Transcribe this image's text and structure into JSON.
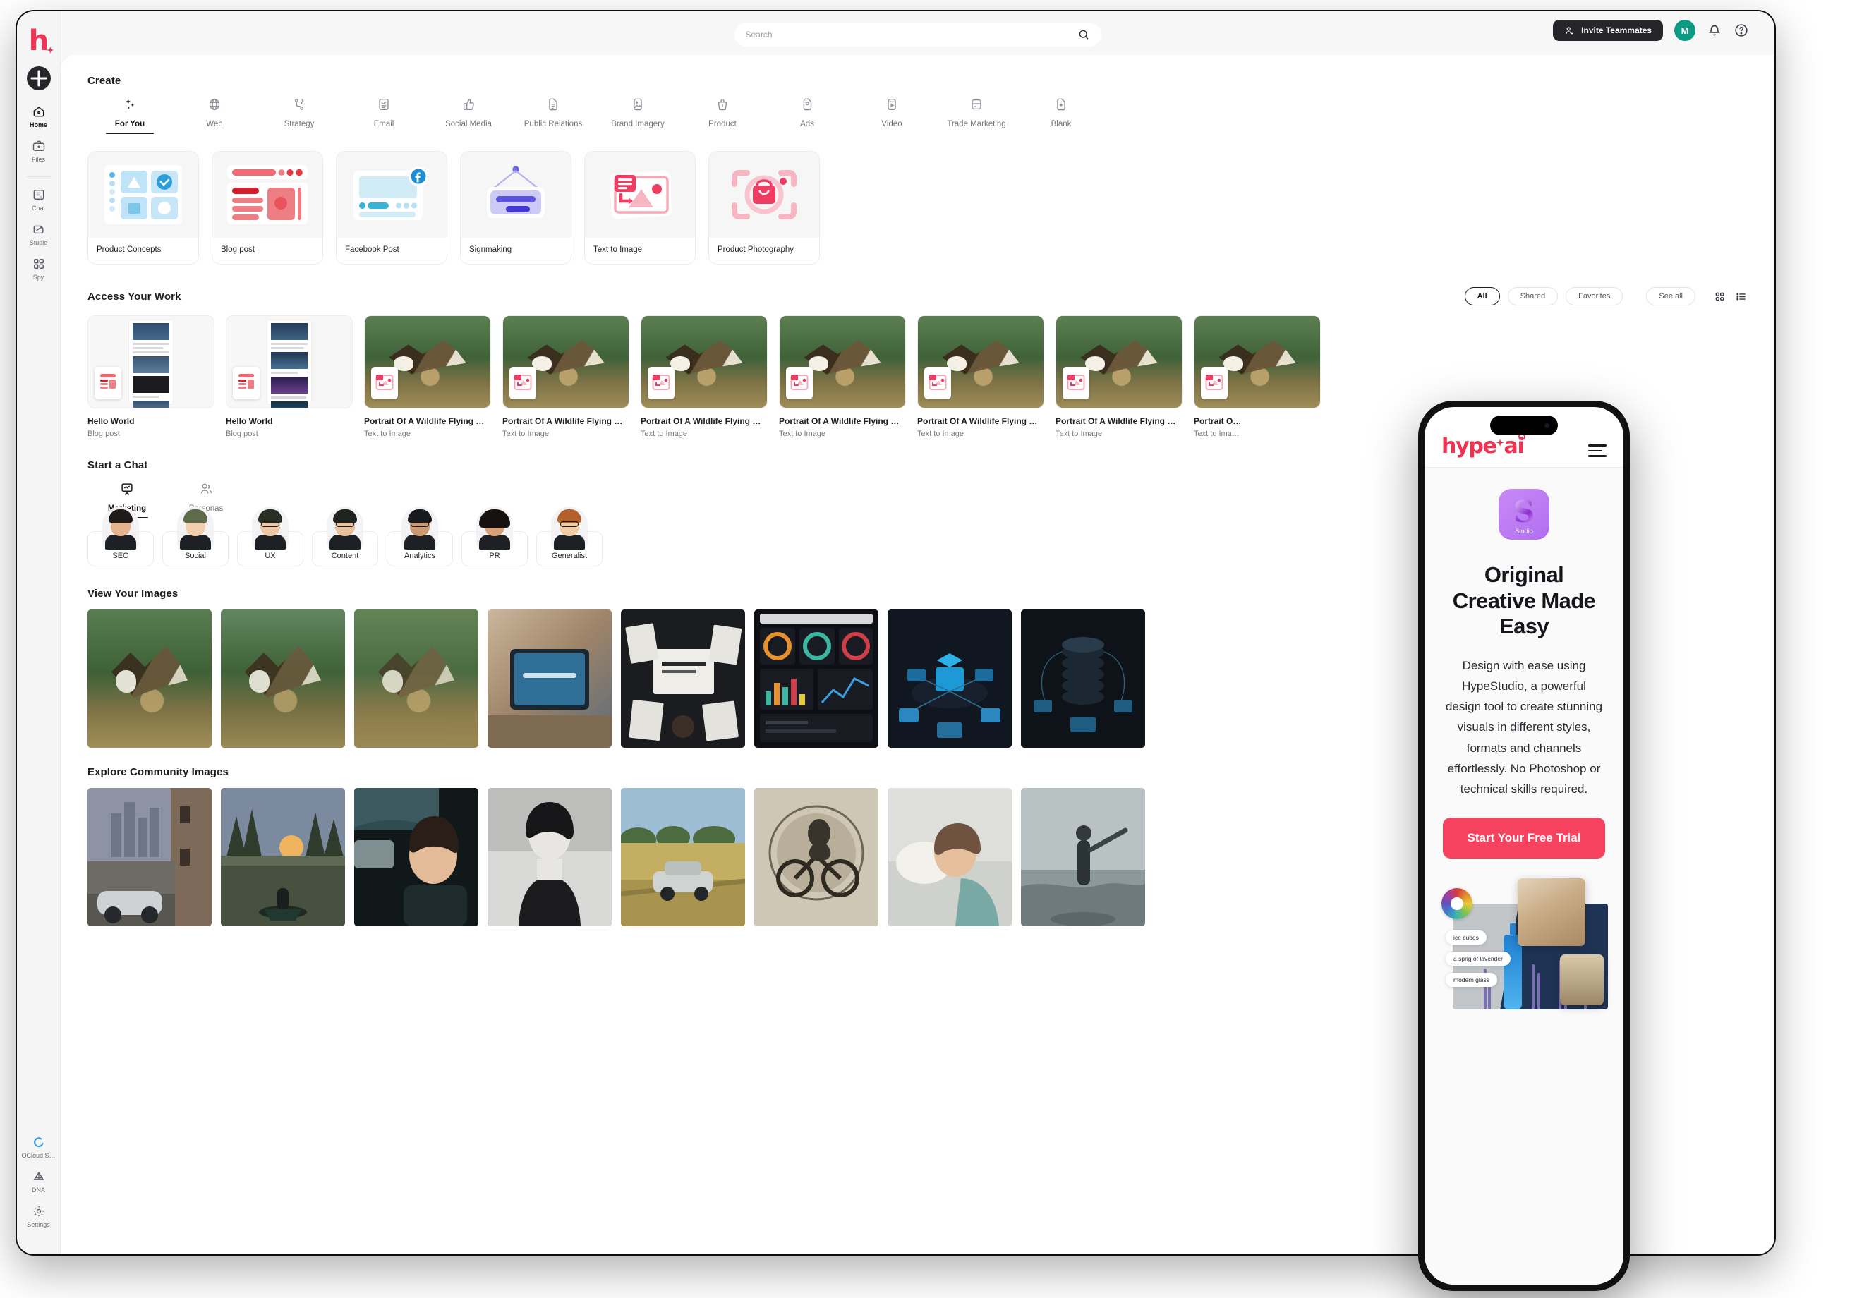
{
  "brand": {
    "logo_letter": "h",
    "name": "hype ai"
  },
  "rail": {
    "add_label": "+",
    "items": [
      {
        "label": "Home",
        "icon": "home-icon",
        "active": true
      },
      {
        "label": "Files",
        "icon": "briefcase-icon",
        "active": false
      },
      {
        "label": "Chat",
        "icon": "chat-doc-icon",
        "active": false
      },
      {
        "label": "Studio",
        "icon": "studio-icon",
        "active": false
      },
      {
        "label": "Spy",
        "icon": "grid-icon",
        "active": false
      }
    ],
    "bottom_items": [
      {
        "label": "OCloud S…",
        "icon": "cloud-loader-icon"
      },
      {
        "label": "DNA",
        "icon": "dna-icon"
      },
      {
        "label": "Settings",
        "icon": "gear-icon"
      }
    ]
  },
  "topbar": {
    "search_placeholder": "Search",
    "search_value": "",
    "invite_label": "Invite Teammates",
    "avatar_initial": "M",
    "icons": [
      "search-icon",
      "person-add-icon",
      "bell-icon",
      "help-circle-icon"
    ]
  },
  "create": {
    "title": "Create",
    "tabs": [
      {
        "label": "For You",
        "icon": "sparkle-icon",
        "active": true
      },
      {
        "label": "Web",
        "icon": "globe-icon",
        "active": false
      },
      {
        "label": "Strategy",
        "icon": "branch-icon",
        "active": false
      },
      {
        "label": "Email",
        "icon": "email-doc-icon",
        "active": false
      },
      {
        "label": "Social Media",
        "icon": "thumbs-up-icon",
        "active": false
      },
      {
        "label": "Public Relations",
        "icon": "doc-lines-icon",
        "active": false
      },
      {
        "label": "Brand Imagery",
        "icon": "image-doc-icon",
        "active": false
      },
      {
        "label": "Product",
        "icon": "basket-icon",
        "active": false
      },
      {
        "label": "Ads",
        "icon": "tag-pin-icon",
        "active": false
      },
      {
        "label": "Video",
        "icon": "video-play-icon",
        "active": false
      },
      {
        "label": "Trade Marketing",
        "icon": "card-icon",
        "active": false
      },
      {
        "label": "Blank",
        "icon": "doc-plus-icon",
        "active": false
      }
    ],
    "templates": [
      {
        "name": "Product Concepts",
        "art": "product-concepts-art"
      },
      {
        "name": "Blog post",
        "art": "blog-post-art"
      },
      {
        "name": "Facebook Post",
        "art": "facebook-post-art"
      },
      {
        "name": "Signmaking",
        "art": "signmaking-art"
      },
      {
        "name": "Text to Image",
        "art": "text-to-image-art"
      },
      {
        "name": "Product Photography",
        "art": "product-photography-art"
      }
    ]
  },
  "work": {
    "title": "Access Your Work",
    "filters": [
      {
        "label": "All",
        "active": true
      },
      {
        "label": "Shared",
        "active": false
      },
      {
        "label": "Favorites",
        "active": false
      },
      {
        "label": "See all",
        "active": false
      }
    ],
    "view_icons": [
      "grid-view-icon",
      "list-view-icon"
    ],
    "items": [
      {
        "title": "Hello World",
        "subtitle": "Blog post",
        "thumb": "doc"
      },
      {
        "title": "Hello World",
        "subtitle": "Blog post",
        "thumb": "doc"
      },
      {
        "title": "Portrait Of A Wildlife Flying …",
        "subtitle": "Text to Image",
        "thumb": "eagle"
      },
      {
        "title": "Portrait Of A Wildlife Flying …",
        "subtitle": "Text to Image",
        "thumb": "eagle"
      },
      {
        "title": "Portrait Of A Wildlife Flying …",
        "subtitle": "Text to Image",
        "thumb": "eagle"
      },
      {
        "title": "Portrait Of A Wildlife Flying …",
        "subtitle": "Text to Image",
        "thumb": "eagle"
      },
      {
        "title": "Portrait Of A Wildlife Flying …",
        "subtitle": "Text to Image",
        "thumb": "eagle"
      },
      {
        "title": "Portrait Of A Wildlife Flying …",
        "subtitle": "Text to Image",
        "thumb": "eagle"
      },
      {
        "title": "Portrait O…",
        "subtitle": "Text to Ima…",
        "thumb": "eagle"
      }
    ]
  },
  "chat": {
    "title": "Start a Chat",
    "tabs": [
      {
        "label": "Marketing",
        "icon": "presentation-icon",
        "active": true
      },
      {
        "label": "Personas",
        "icon": "people-icon",
        "active": false
      }
    ],
    "personas": [
      {
        "label": "SEO",
        "skin": "#e4b48f",
        "hair": "#1e1b18",
        "glasses": false
      },
      {
        "label": "Social",
        "skin": "#f1cfae",
        "hair": "#5d6b4a",
        "glasses": false
      },
      {
        "label": "UX",
        "skin": "#eec8a6",
        "hair": "#2a2f25",
        "glasses": true
      },
      {
        "label": "Content",
        "skin": "#e8c2a0",
        "hair": "#20231d",
        "glasses": true
      },
      {
        "label": "Analytics",
        "skin": "#c99a72",
        "hair": "#191a1d",
        "glasses": true
      },
      {
        "label": "PR",
        "skin": "#d7a079",
        "hair": "#15120f",
        "glasses": false
      },
      {
        "label": "Generalist",
        "skin": "#f0cda7",
        "hair": "#b2612a",
        "glasses": true
      }
    ]
  },
  "your_images": {
    "title": "View Your Images",
    "tiles": [
      {
        "alt": "bald eagle flying over forest",
        "scene": "sc-eagle1"
      },
      {
        "alt": "bald eagle landing",
        "scene": "sc-eagle2"
      },
      {
        "alt": "bird flying over grass",
        "scene": "sc-bird"
      },
      {
        "alt": "hands holding tablet on desk",
        "scene": "sc-tablet"
      },
      {
        "alt": "tech desk with papers and laptop",
        "scene": "sc-desk"
      },
      {
        "alt": "dark analytics dashboard",
        "scene": "sc-dash"
      },
      {
        "alt": "isometric cloud network diagram",
        "scene": "sc-iso1"
      },
      {
        "alt": "isometric data core diagram",
        "scene": "sc-iso2"
      }
    ]
  },
  "community_images": {
    "title": "Explore Community Images",
    "tiles": [
      {
        "alt": "classic silver car in old city",
        "scene": "sc-city"
      },
      {
        "alt": "canoe on lake at sunset",
        "scene": "sc-lake"
      },
      {
        "alt": "woman driving a car",
        "scene": "sc-car"
      },
      {
        "alt": "black and white portrait",
        "scene": "sc-bw"
      },
      {
        "alt": "vintage car in wheat field",
        "scene": "sc-field"
      },
      {
        "alt": "engraved motorcycle rider",
        "scene": "sc-moto"
      },
      {
        "alt": "woman sleeping in bed",
        "scene": "sc-sleep"
      },
      {
        "alt": "surfer walking on beach",
        "scene": "sc-surf"
      }
    ]
  },
  "phone": {
    "logo_main": "hype",
    "logo_tail": "ai",
    "menu_icon": "hamburger-icon",
    "app_icon_letter": "S",
    "app_icon_caption": "Studio",
    "headline": "Original Creative Made Easy",
    "body": "Design with ease using HypeStudio, a powerful design tool to create stunning visuals in different styles, formats and channels effortlessly. No Photoshop or technical skills required.",
    "cta_label": "Start Your Free Trial",
    "art_chips": [
      "ice cubes",
      "a sprig of lavender",
      "modern glass"
    ],
    "accent_color": "#f5435f"
  },
  "colors": {
    "brand_red": "#ef3352",
    "cta_red": "#f5435f",
    "avatar_teal": "#0d9a85",
    "dark": "#26262a",
    "studio_purple": "#b06ef0"
  }
}
